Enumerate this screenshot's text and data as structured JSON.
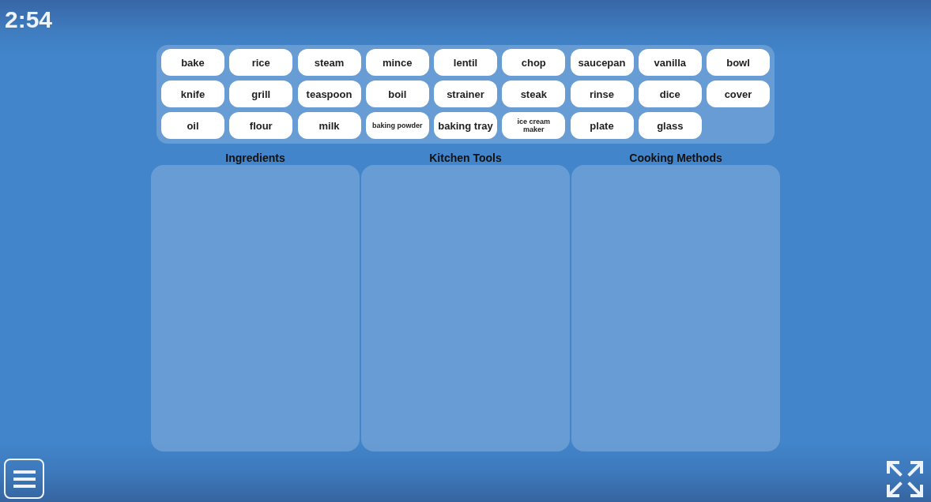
{
  "timer": "2:54",
  "word_bank": {
    "cards": [
      "bake",
      "rice",
      "steam",
      "mince",
      "lentil",
      "chop",
      "saucepan",
      "vanilla",
      "bowl",
      "knife",
      "grill",
      "teaspoon",
      "boil",
      "strainer",
      "steak",
      "rinse",
      "dice",
      "cover",
      "oil",
      "flour",
      "milk",
      "baking powder",
      "baking tray",
      "ice cream maker",
      "plate",
      "glass"
    ]
  },
  "categories": [
    {
      "title": "Ingredients"
    },
    {
      "title": "Kitchen Tools"
    },
    {
      "title": "Cooking Methods"
    }
  ]
}
